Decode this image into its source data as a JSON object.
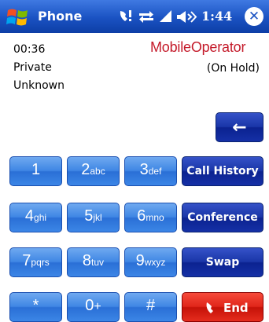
{
  "titlebar": {
    "app_title": "Phone",
    "time": "1:44",
    "icons": [
      "windows-start-flag-icon",
      "call-status-icon",
      "connectivity-icon",
      "signal-strength-icon",
      "speaker-volume-icon",
      "close-icon"
    ],
    "close_glyph": "✕"
  },
  "call": {
    "duration": "00:36",
    "caller_name": "Private",
    "caller_number": "Unknown",
    "operator_logo": "MobileOperator",
    "status": "(On Hold)"
  },
  "backspace": {
    "glyph": "←"
  },
  "keypad": [
    {
      "digit": "1",
      "letters": ""
    },
    {
      "digit": "2",
      "letters": "abc"
    },
    {
      "digit": "3",
      "letters": "def"
    },
    {
      "digit": "4",
      "letters": "ghi"
    },
    {
      "digit": "5",
      "letters": "jkl"
    },
    {
      "digit": "6",
      "letters": "mno"
    },
    {
      "digit": "7",
      "letters": "pqrs"
    },
    {
      "digit": "8",
      "letters": "tuv"
    },
    {
      "digit": "9",
      "letters": "wxyz"
    },
    {
      "digit": "*",
      "letters": ""
    },
    {
      "digit": "0",
      "letters": "+"
    },
    {
      "digit": "#",
      "letters": ""
    }
  ],
  "actions": {
    "call_history": "Call History",
    "conference": "Conference",
    "swap": "Swap",
    "end": "End"
  },
  "colors": {
    "titlebar": "#1a52c2",
    "keypad_blue": "#3f86e4",
    "function_navy": "#1a36a8",
    "end_red": "#e0261a",
    "operator_red": "#c41a2a"
  }
}
